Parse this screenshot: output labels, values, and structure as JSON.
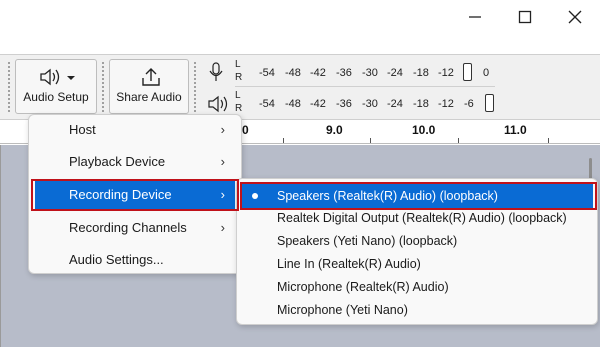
{
  "toolbar": {
    "audio_setup_label": "Audio Setup",
    "share_audio_label": "Share Audio",
    "meter_ticks": [
      "-54",
      "-48",
      "-42",
      "-36",
      "-30",
      "-24",
      "-18",
      "-12",
      "",
      "0"
    ],
    "meter_ticks_playback": [
      "-54",
      "-48",
      "-42",
      "-36",
      "-30",
      "-24",
      "-18",
      "-12",
      "-6",
      ""
    ],
    "lr_left": "L",
    "lr_right": "R"
  },
  "ruler": {
    "ticks": [
      "0",
      "9.0",
      "10.0",
      "11.0"
    ]
  },
  "audio_setup_menu": {
    "items": [
      {
        "label": "Host",
        "has_submenu": true,
        "highlighted": false
      },
      {
        "label": "Playback Device",
        "has_submenu": true,
        "highlighted": false
      },
      {
        "label": "Recording Device",
        "has_submenu": true,
        "highlighted": true
      },
      {
        "label": "Recording Channels",
        "has_submenu": true,
        "highlighted": false
      },
      {
        "label": "Audio Settings...",
        "has_submenu": false,
        "highlighted": false
      }
    ],
    "arrow_glyph": "›"
  },
  "recording_device_submenu": {
    "items": [
      {
        "label": "Speakers (Realtek(R) Audio) (loopback)",
        "selected": true
      },
      {
        "label": "Realtek Digital Output (Realtek(R) Audio) (loopback)",
        "selected": false
      },
      {
        "label": "Speakers (Yeti Nano) (loopback)",
        "selected": false
      },
      {
        "label": "Line In (Realtek(R) Audio)",
        "selected": false
      },
      {
        "label": "Microphone (Realtek(R) Audio)",
        "selected": false
      },
      {
        "label": "Microphone (Yeti Nano)",
        "selected": false
      }
    ]
  },
  "colors": {
    "highlight": "#0a6bd4",
    "annotation": "#c0121a",
    "track_background": "#b7bcc9"
  }
}
